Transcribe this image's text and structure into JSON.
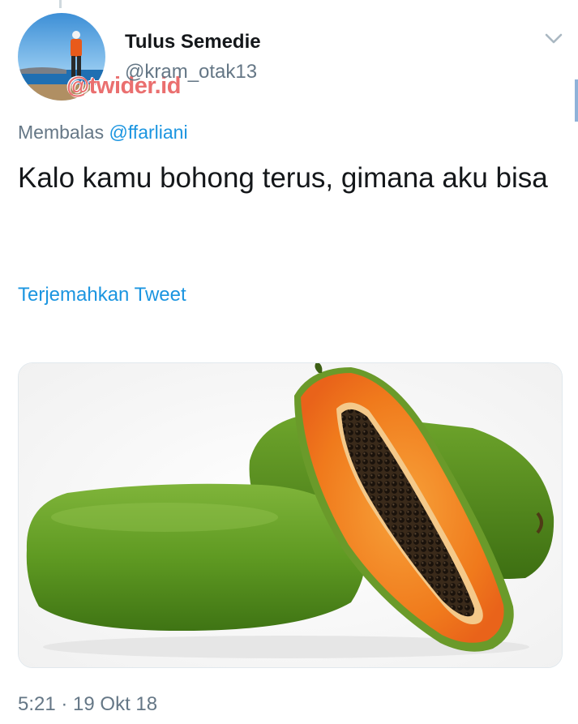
{
  "tweet": {
    "author": {
      "display_name": "Tulus Semedie",
      "handle": "@kram_otak13",
      "avatar_description_icon": "profile-photo"
    },
    "watermark": "@twider.id",
    "reply_prefix": "Membalas ",
    "reply_to": "@ffarliani",
    "text": "Kalo kamu bohong terus, gimana aku bisa",
    "translate_label": "Terjemahkan Tweet",
    "media": {
      "type": "photo",
      "subject": "papaya"
    },
    "timestamp": "5:21 · 19 Okt 18",
    "menu_icon": "chevron-down-icon"
  },
  "colors": {
    "text": "#14171a",
    "secondary": "#657786",
    "link": "#1b95e0",
    "watermark": "#ea6f6f"
  }
}
